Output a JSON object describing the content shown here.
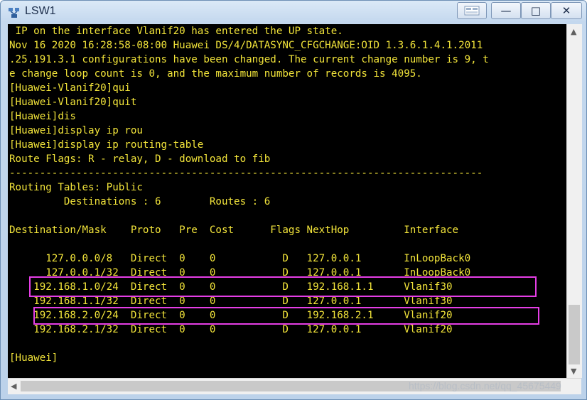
{
  "window": {
    "title": "LSW1"
  },
  "terminal": {
    "lines": [
      " IP on the interface Vlanif20 has entered the UP state.",
      "Nov 16 2020 16:28:58-08:00 Huawei DS/4/DATASYNC_CFGCHANGE:OID 1.3.6.1.4.1.2011",
      ".25.191.3.1 configurations have been changed. The current change number is 9, t",
      "e change loop count is 0, and the maximum number of records is 4095.",
      "[Huawei-Vlanif20]qui",
      "[Huawei-Vlanif20]quit",
      "[Huawei]dis",
      "[Huawei]display ip rou",
      "[Huawei]display ip routing-table",
      "Route Flags: R - relay, D - download to fib",
      "------------------------------------------------------------------------------",
      "Routing Tables: Public",
      "         Destinations : 6        Routes : 6",
      "",
      "Destination/Mask    Proto   Pre  Cost      Flags NextHop         Interface",
      "",
      "      127.0.0.0/8   Direct  0    0           D   127.0.0.1       InLoopBack0",
      "      127.0.0.1/32  Direct  0    0           D   127.0.0.1       InLoopBack0",
      "    192.168.1.0/24  Direct  0    0           D   192.168.1.1     Vlanif30",
      "    192.168.1.1/32  Direct  0    0           D   127.0.0.1       Vlanif30",
      "    192.168.2.0/24  Direct  0    0           D   192.168.2.1     Vlanif20",
      "    192.168.2.1/32  Direct  0    0           D   127.0.0.1       Vlanif20",
      "",
      "[Huawei]"
    ]
  },
  "watermark": "https://blog.csdn.net/qq_45675449",
  "colors": {
    "terminal_text": "#f2e43a",
    "terminal_bg": "#000000",
    "highlight": "#e63ee6"
  }
}
